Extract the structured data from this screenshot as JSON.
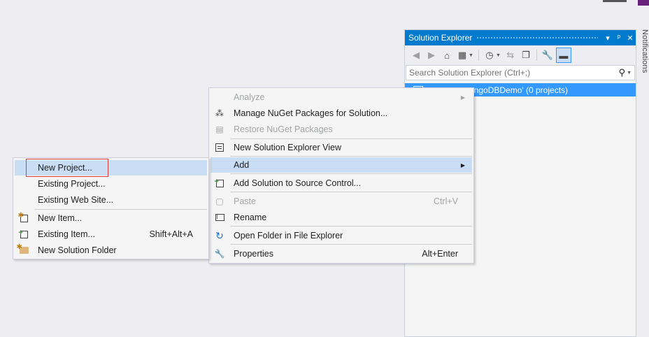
{
  "solution_explorer": {
    "title": "Solution Explorer",
    "title_buttons": [
      "▾",
      "ᵖ",
      "✕"
    ],
    "search_placeholder": "Search Solution Explorer (Ctrl+;)",
    "tree_item": "ongoDBDemo' (0 projects)"
  },
  "notifications_tab": "Notifications",
  "context_menu": {
    "items": [
      {
        "label": "Analyze",
        "shortcut": "",
        "disabled": true,
        "submenu": true,
        "icon": ""
      },
      {
        "label": "Manage NuGet Packages for Solution...",
        "shortcut": "",
        "disabled": false,
        "icon": "nuget-icon"
      },
      {
        "label": "Restore NuGet Packages",
        "shortcut": "",
        "disabled": true,
        "icon": "restore-icon"
      },
      {
        "label": "New Solution Explorer View",
        "shortcut": "",
        "disabled": false,
        "icon": "new-view-icon"
      },
      {
        "label": "Add",
        "shortcut": "",
        "disabled": false,
        "submenu": true,
        "highlighted": true
      },
      {
        "label": "Add Solution to Source Control...",
        "shortcut": "",
        "disabled": false,
        "icon": "add-source-control-icon"
      },
      {
        "label": "Paste",
        "shortcut": "Ctrl+V",
        "disabled": true,
        "icon": "paste-icon"
      },
      {
        "label": "Rename",
        "shortcut": "",
        "disabled": false,
        "icon": "rename-icon"
      },
      {
        "label": "Open Folder in File Explorer",
        "shortcut": "",
        "disabled": false,
        "icon": "refresh-arrow-icon"
      },
      {
        "label": "Properties",
        "shortcut": "Alt+Enter",
        "disabled": false,
        "icon": "wrench-icon"
      }
    ]
  },
  "add_submenu": {
    "items": [
      {
        "label": "New Project...",
        "shortcut": "",
        "highlighted": true
      },
      {
        "label": "Existing Project...",
        "shortcut": ""
      },
      {
        "label": "Existing Web Site...",
        "shortcut": ""
      },
      {
        "label": "New Item...",
        "shortcut": "",
        "icon": "new-item-icon"
      },
      {
        "label": "Existing Item...",
        "shortcut": "Shift+Alt+A",
        "icon": "existing-item-icon"
      },
      {
        "label": "New Solution Folder",
        "shortcut": "",
        "icon": "new-folder-icon"
      }
    ]
  },
  "colors": {
    "accent": "#007acc",
    "selection": "#3399ff",
    "menu_hover": "#c9def5",
    "callout_border": "#e03c3c"
  }
}
